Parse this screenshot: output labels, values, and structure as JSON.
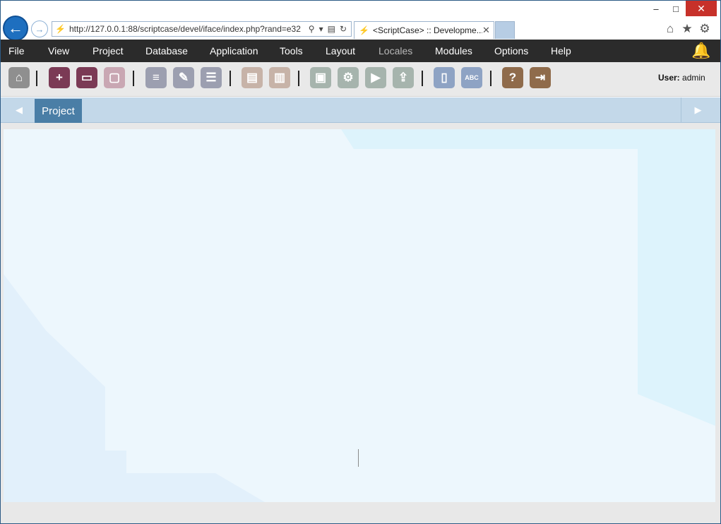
{
  "browser": {
    "address_url": "http://127.0.0.1:88/scriptcase/devel/iface/index.php?rand=e32",
    "tab_title": "<ScriptCase> :: Developme...",
    "window_controls": {
      "minimize": "–",
      "maximize": "□",
      "close": "✕"
    },
    "icons": [
      "back-icon",
      "forward-icon",
      "search-icon",
      "dropdown-icon",
      "compat-icon",
      "refresh-icon",
      "home-icon",
      "favorites-star-icon",
      "settings-gear-icon",
      "tab-close-icon"
    ]
  },
  "menu": {
    "items": [
      "File",
      "View",
      "Project",
      "Database",
      "Application",
      "Tools",
      "Layout",
      "Locales",
      "Modules",
      "Options",
      "Help"
    ],
    "disabled": [
      "Locales"
    ]
  },
  "toolbar": {
    "user_label": "User:",
    "user_name": "admin",
    "buttons": [
      {
        "name": "home",
        "color": "#8f8f8f"
      },
      {
        "name": "new-project",
        "color": "#7b3a55"
      },
      {
        "name": "open-project",
        "color": "#7b3a55"
      },
      {
        "name": "project-box",
        "color": "#c9a7b3"
      },
      {
        "name": "new-application",
        "color": "#9c9fb0"
      },
      {
        "name": "edit-application",
        "color": "#9c9fb0"
      },
      {
        "name": "database",
        "color": "#9c9fb0"
      },
      {
        "name": "document",
        "color": "#c7b3a8"
      },
      {
        "name": "documents",
        "color": "#c7b3a8"
      },
      {
        "name": "save",
        "color": "#a6b4ad"
      },
      {
        "name": "generate",
        "color": "#a6b4ad"
      },
      {
        "name": "run",
        "color": "#a6b4ad"
      },
      {
        "name": "deploy",
        "color": "#a6b4ad"
      },
      {
        "name": "book",
        "color": "#8ea3c4"
      },
      {
        "name": "spelling",
        "color": "#8ea3c4"
      },
      {
        "name": "help",
        "color": "#8f6b4b"
      },
      {
        "name": "exit",
        "color": "#8f6b4b"
      }
    ]
  },
  "tabstrip": {
    "active_tab": "Project",
    "left_arrow": "◀",
    "right_arrow": "▶"
  },
  "colors": {
    "menubar_bg": "#2b2b2b",
    "tabstrip_bg": "#c3d8e9",
    "active_tab_bg": "#4a7ea6",
    "canvas_bg": "#edf7fd"
  }
}
